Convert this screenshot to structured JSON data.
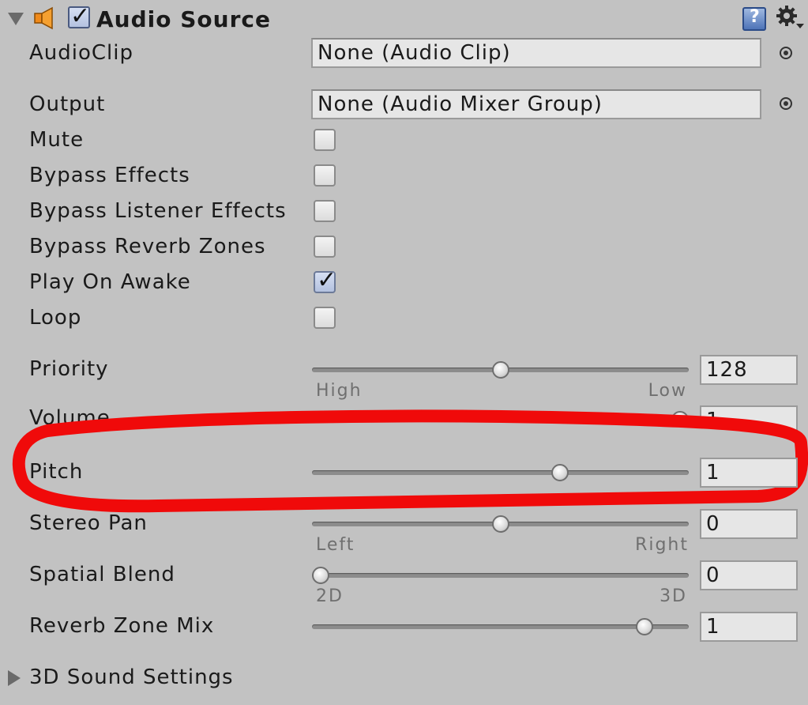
{
  "component": {
    "title": "Audio Source",
    "enabled": true,
    "help_icon": "help-book-icon",
    "settings_icon": "gear-icon",
    "component_icon": "speaker-icon"
  },
  "fields": {
    "audio_clip": {
      "label": "AudioClip",
      "value": "None (Audio Clip)"
    },
    "output": {
      "label": "Output",
      "value": "None (Audio Mixer Group)"
    },
    "mute": {
      "label": "Mute",
      "checked": false
    },
    "bypass_effects": {
      "label": "Bypass Effects",
      "checked": false
    },
    "bypass_listener_effects": {
      "label": "Bypass Listener Effects",
      "checked": false
    },
    "bypass_reverb_zones": {
      "label": "Bypass Reverb Zones",
      "checked": false
    },
    "play_on_awake": {
      "label": "Play On Awake",
      "checked": true
    },
    "loop": {
      "label": "Loop",
      "checked": false
    },
    "priority": {
      "label": "Priority",
      "value": "128",
      "min_label": "High",
      "max_label": "Low",
      "fraction": 0.5
    },
    "volume": {
      "label": "Volume",
      "value": "1",
      "fraction": 1.0
    },
    "pitch": {
      "label": "Pitch",
      "value": "1",
      "fraction": 0.667
    },
    "stereo_pan": {
      "label": "Stereo Pan",
      "value": "0",
      "min_label": "Left",
      "max_label": "Right",
      "fraction": 0.5
    },
    "spatial_blend": {
      "label": "Spatial Blend",
      "value": "0",
      "min_label": "2D",
      "max_label": "3D",
      "fraction": 0.0
    },
    "reverb_zone_mix": {
      "label": "Reverb Zone Mix",
      "value": "1",
      "fraction": 0.9
    }
  },
  "foldout": {
    "label": "3D Sound Settings",
    "expanded": false
  },
  "annotation": {
    "color": "#f00a0a"
  }
}
